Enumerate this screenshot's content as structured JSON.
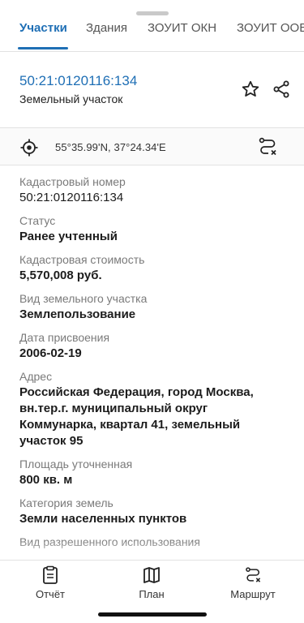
{
  "tabs": [
    {
      "label": "Участки",
      "active": true
    },
    {
      "label": "Здания",
      "active": false
    },
    {
      "label": "ЗОУИТ ОКН",
      "active": false
    },
    {
      "label": "ЗОУИТ ООБ",
      "active": false
    }
  ],
  "header": {
    "cadastral_link": "50:21:0120116:134",
    "object_type": "Земельный участок"
  },
  "location": {
    "coordinates": "55°35.99'N, 37°24.34'E"
  },
  "details": [
    {
      "label": "Кадастровый номер",
      "value": "50:21:0120116:134"
    },
    {
      "label": "Статус",
      "value": "Ранее учтенный"
    },
    {
      "label": "Кадастровая стоимость",
      "value": "5,570,008 руб."
    },
    {
      "label": "Вид земельного участка",
      "value": "Землепользование"
    },
    {
      "label": "Дата присвоения",
      "value": "2006-02-19"
    },
    {
      "label": "Адрес",
      "value": "Российская Федерация, город Москва, вн.тер.г. муниципальный округ Коммунарка, квартал 41, земельный участок 95"
    },
    {
      "label": "Площадь уточненная",
      "value": "800 кв. м"
    },
    {
      "label": "Категория земель",
      "value": "Земли населенных пунктов"
    },
    {
      "label": "Вид разрешенного использования",
      "value": ""
    }
  ],
  "bottom_bar": {
    "report_label": "Отчёт",
    "plan_label": "План",
    "route_label": "Маршрут"
  },
  "colors": {
    "accent": "#1f6fb5"
  }
}
